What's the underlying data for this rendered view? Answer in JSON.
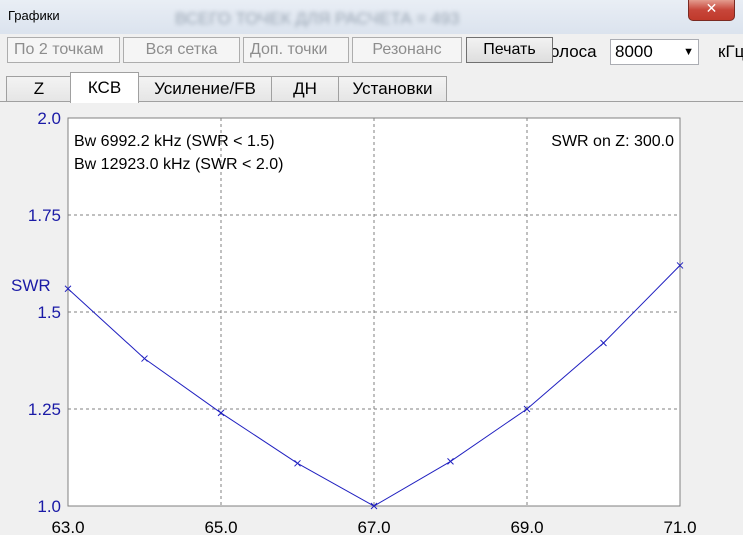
{
  "window": {
    "title": "Графики",
    "close_icon": "close-icon",
    "background_title": "ВСЕГО ТОЧЕК ДЛЯ РАСЧЕТА = 493"
  },
  "toolbar": {
    "buttons": [
      {
        "label": "По 2 точкам",
        "enabled": false
      },
      {
        "label": "Вся сетка",
        "enabled": false
      },
      {
        "label": "Доп. точки",
        "enabled": false
      },
      {
        "label": "Резонанс",
        "enabled": false
      },
      {
        "label": "Печать",
        "enabled": true
      }
    ],
    "band_label": "олоса",
    "band_value": "8000",
    "band_unit": "кГц"
  },
  "tabs": [
    {
      "label": "Z",
      "active": false
    },
    {
      "label": "КСВ",
      "active": true
    },
    {
      "label": "Усиление/FB",
      "active": false
    },
    {
      "label": "ДН",
      "active": false
    },
    {
      "label": "Установки",
      "active": false
    }
  ],
  "chart_data": {
    "type": "line",
    "ylabel": "SWR",
    "x_ticks": [
      "63.0",
      "65.0",
      "67.0",
      "69.0",
      "71.0"
    ],
    "y_ticks": [
      "1.0",
      "1.25",
      "1.5",
      "1.75",
      "2.0"
    ],
    "xlim": [
      63.0,
      71.0
    ],
    "ylim": [
      1.0,
      2.0
    ],
    "grid": true,
    "annotations": {
      "bw15": "Bw 6992.2 kHz (SWR < 1.5)",
      "bw20": "Bw 12923.0 kHz (SWR < 2.0)",
      "swr_on_z": "SWR on Z: 300.0"
    },
    "series": [
      {
        "color": "#2020c0",
        "x": [
          63.0,
          64.0,
          65.0,
          66.0,
          67.0,
          68.0,
          69.0,
          70.0,
          71.0
        ],
        "y": [
          1.56,
          1.38,
          1.24,
          1.11,
          1.0,
          1.115,
          1.25,
          1.42,
          1.62
        ]
      }
    ],
    "colors": {
      "axis_text": "#1a1aa6",
      "grid": "#808080",
      "line": "#2020c0"
    }
  }
}
